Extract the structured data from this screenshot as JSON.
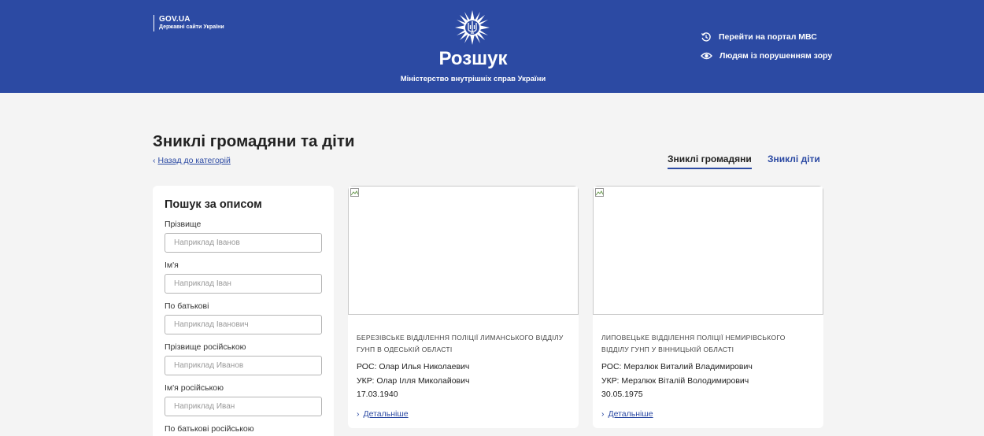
{
  "header": {
    "gov_title": "GOV.UA",
    "gov_subtitle": "Державні сайти України",
    "emblem_icon": "trident-star-icon",
    "site_title": "Розшук",
    "site_subtitle": "Міністерство внутрішніх справ України",
    "links": [
      {
        "label": "Перейти на портал МВС",
        "icon": "history-arrow-icon"
      },
      {
        "label": "Людям із порушенням зору",
        "icon": "eye-icon"
      }
    ],
    "color": "#2c4aa3"
  },
  "page": {
    "title": "Зниклі громадяни та діти",
    "back_arrow": "‹",
    "back_label": "Назад до категорій",
    "tabs": [
      {
        "label": "Зниклі громадяни",
        "active": true
      },
      {
        "label": "Зниклі діти",
        "active": false
      }
    ]
  },
  "search": {
    "title": "Пошук за описом",
    "fields": [
      {
        "label": "Прізвище",
        "placeholder": "Наприклад Іванов"
      },
      {
        "label": "Ім'я",
        "placeholder": "Наприклад Іван"
      },
      {
        "label": "По батькові",
        "placeholder": "Наприклад Іванович"
      },
      {
        "label": "Прізвище російською",
        "placeholder": "Наприклад Иванов"
      },
      {
        "label": "Ім'я російською",
        "placeholder": "Наприклад Иван"
      },
      {
        "label": "По батькові російською",
        "placeholder": ""
      }
    ]
  },
  "cards": [
    {
      "department": "Березівське відділення поліції Лиманського відділу ГУНП в Одеській області",
      "name_ru": "РОС: Олар Илья Николаевич",
      "name_uk": "УКР: Олар Ілля Миколайович",
      "date": "17.03.1940",
      "details_label": "Детальніше"
    },
    {
      "department": "Липовецьке відділення поліції Немирівського відділу ГУНП у Вінницькій області",
      "name_ru": "РОС: Мерзлюк Виталий Владимирович",
      "name_uk": "УКР: Мерзлюк Віталій Володимирович",
      "date": "30.05.1975",
      "details_label": "Детальніше"
    }
  ]
}
